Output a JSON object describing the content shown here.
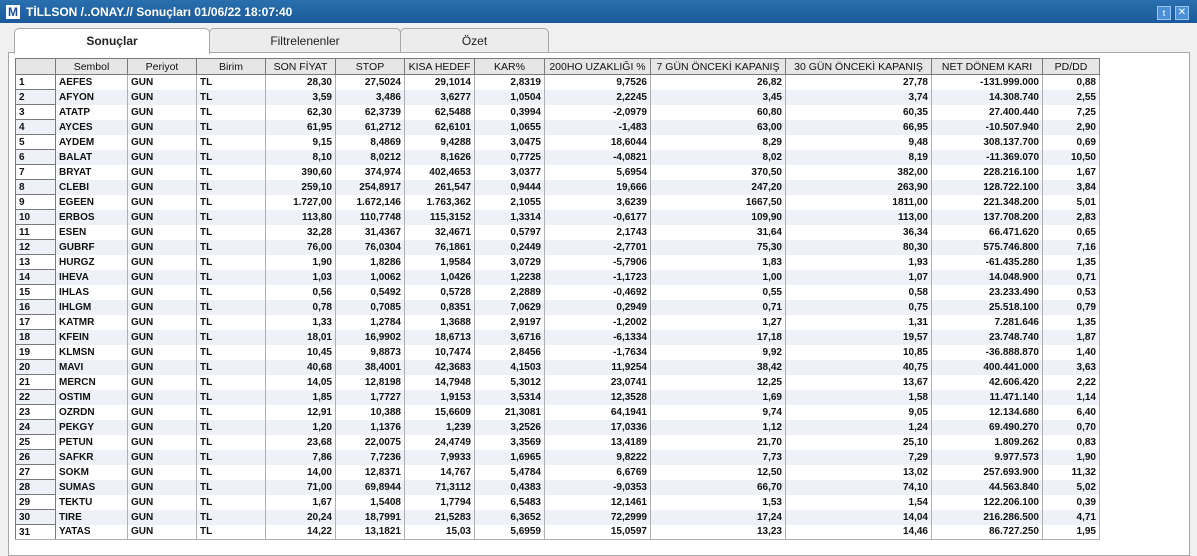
{
  "window": {
    "app_icon": "M",
    "title": "TİLLSON /..ONAY.// Sonuçları  01/06/22 18:07:40",
    "twitter_icon": "twitter-icon",
    "close_icon": "close-icon"
  },
  "tabs": [
    {
      "label": "Sonuçlar",
      "active": true
    },
    {
      "label": "Filtrelenenler",
      "active": false
    },
    {
      "label": "Özet",
      "active": false
    }
  ],
  "table": {
    "columns": [
      "",
      "Sembol",
      "Periyot",
      "Birim",
      "SON FİYAT",
      "STOP",
      "KISA HEDEF",
      "KAR%",
      "200HO UZAKLIĞI %",
      "7 GÜN ÖNCEKİ KAPANIŞ",
      "30 GÜN ÖNCEKİ KAPANIŞ",
      "NET DÖNEM KARI",
      "PD/DD"
    ],
    "rows": [
      [
        "1",
        "AEFES",
        "GUN",
        "TL",
        "28,30",
        "27,5024",
        "29,1014",
        "2,8319",
        "9,7526",
        "26,82",
        "27,78",
        "-131.999.000",
        "0,88"
      ],
      [
        "2",
        "AFYON",
        "GUN",
        "TL",
        "3,59",
        "3,486",
        "3,6277",
        "1,0504",
        "2,2245",
        "3,45",
        "3,74",
        "14.308.740",
        "2,55"
      ],
      [
        "3",
        "ATATP",
        "GUN",
        "TL",
        "62,30",
        "62,3739",
        "62,5488",
        "0,3994",
        "-2,0979",
        "60,80",
        "60,35",
        "27.400.440",
        "7,25"
      ],
      [
        "4",
        "AYCES",
        "GUN",
        "TL",
        "61,95",
        "61,2712",
        "62,6101",
        "1,0655",
        "-1,483",
        "63,00",
        "66,95",
        "-10.507.940",
        "2,90"
      ],
      [
        "5",
        "AYDEM",
        "GUN",
        "TL",
        "9,15",
        "8,4869",
        "9,4288",
        "3,0475",
        "18,6044",
        "8,29",
        "9,48",
        "308.137.700",
        "0,69"
      ],
      [
        "6",
        "BALAT",
        "GUN",
        "TL",
        "8,10",
        "8,0212",
        "8,1626",
        "0,7725",
        "-4,0821",
        "8,02",
        "8,19",
        "-11.369.070",
        "10,50"
      ],
      [
        "7",
        "BRYAT",
        "GUN",
        "TL",
        "390,60",
        "374,974",
        "402,4653",
        "3,0377",
        "5,6954",
        "370,50",
        "382,00",
        "228.216.100",
        "1,67"
      ],
      [
        "8",
        "CLEBI",
        "GUN",
        "TL",
        "259,10",
        "254,8917",
        "261,547",
        "0,9444",
        "19,666",
        "247,20",
        "263,90",
        "128.722.100",
        "3,84"
      ],
      [
        "9",
        "EGEEN",
        "GUN",
        "TL",
        "1.727,00",
        "1.672,146",
        "1.763,362",
        "2,1055",
        "3,6239",
        "1667,50",
        "1811,00",
        "221.348.200",
        "5,01"
      ],
      [
        "10",
        "ERBOS",
        "GUN",
        "TL",
        "113,80",
        "110,7748",
        "115,3152",
        "1,3314",
        "-0,6177",
        "109,90",
        "113,00",
        "137.708.200",
        "2,83"
      ],
      [
        "11",
        "ESEN",
        "GUN",
        "TL",
        "32,28",
        "31,4367",
        "32,4671",
        "0,5797",
        "2,1743",
        "31,64",
        "36,34",
        "66.471.620",
        "0,65"
      ],
      [
        "12",
        "GUBRF",
        "GUN",
        "TL",
        "76,00",
        "76,0304",
        "76,1861",
        "0,2449",
        "-2,7701",
        "75,30",
        "80,30",
        "575.746.800",
        "7,16"
      ],
      [
        "13",
        "HURGZ",
        "GUN",
        "TL",
        "1,90",
        "1,8286",
        "1,9584",
        "3,0729",
        "-5,7906",
        "1,83",
        "1,93",
        "-61.435.280",
        "1,35"
      ],
      [
        "14",
        "IHEVA",
        "GUN",
        "TL",
        "1,03",
        "1,0062",
        "1,0426",
        "1,2238",
        "-1,1723",
        "1,00",
        "1,07",
        "14.048.900",
        "0,71"
      ],
      [
        "15",
        "IHLAS",
        "GUN",
        "TL",
        "0,56",
        "0,5492",
        "0,5728",
        "2,2889",
        "-0,4692",
        "0,55",
        "0,58",
        "23.233.490",
        "0,53"
      ],
      [
        "16",
        "IHLGM",
        "GUN",
        "TL",
        "0,78",
        "0,7085",
        "0,8351",
        "7,0629",
        "0,2949",
        "0,71",
        "0,75",
        "25.518.100",
        "0,79"
      ],
      [
        "17",
        "KATMR",
        "GUN",
        "TL",
        "1,33",
        "1,2784",
        "1,3688",
        "2,9197",
        "-1,2002",
        "1,27",
        "1,31",
        "7.281.646",
        "1,35"
      ],
      [
        "18",
        "KFEIN",
        "GUN",
        "TL",
        "18,01",
        "16,9902",
        "18,6713",
        "3,6716",
        "-6,1334",
        "17,18",
        "19,57",
        "23.748.740",
        "1,87"
      ],
      [
        "19",
        "KLMSN",
        "GUN",
        "TL",
        "10,45",
        "9,8873",
        "10,7474",
        "2,8456",
        "-1,7634",
        "9,92",
        "10,85",
        "-36.888.870",
        "1,40"
      ],
      [
        "20",
        "MAVI",
        "GUN",
        "TL",
        "40,68",
        "38,4001",
        "42,3683",
        "4,1503",
        "11,9254",
        "38,42",
        "40,75",
        "400.441.000",
        "3,63"
      ],
      [
        "21",
        "MERCN",
        "GUN",
        "TL",
        "14,05",
        "12,8198",
        "14,7948",
        "5,3012",
        "23,0741",
        "12,25",
        "13,67",
        "42.606.420",
        "2,22"
      ],
      [
        "22",
        "OSTIM",
        "GUN",
        "TL",
        "1,85",
        "1,7727",
        "1,9153",
        "3,5314",
        "12,3528",
        "1,69",
        "1,58",
        "11.471.140",
        "1,14"
      ],
      [
        "23",
        "OZRDN",
        "GUN",
        "TL",
        "12,91",
        "10,388",
        "15,6609",
        "21,3081",
        "64,1941",
        "9,74",
        "9,05",
        "12.134.680",
        "6,40"
      ],
      [
        "24",
        "PEKGY",
        "GUN",
        "TL",
        "1,20",
        "1,1376",
        "1,239",
        "3,2526",
        "17,0336",
        "1,12",
        "1,24",
        "69.490.270",
        "0,70"
      ],
      [
        "25",
        "PETUN",
        "GUN",
        "TL",
        "23,68",
        "22,0075",
        "24,4749",
        "3,3569",
        "13,4189",
        "21,70",
        "25,10",
        "1.809.262",
        "0,83"
      ],
      [
        "26",
        "SAFKR",
        "GUN",
        "TL",
        "7,86",
        "7,7236",
        "7,9933",
        "1,6965",
        "9,8222",
        "7,73",
        "7,29",
        "9.977.573",
        "1,90"
      ],
      [
        "27",
        "SOKM",
        "GUN",
        "TL",
        "14,00",
        "12,8371",
        "14,767",
        "5,4784",
        "6,6769",
        "12,50",
        "13,02",
        "257.693.900",
        "11,32"
      ],
      [
        "28",
        "SUMAS",
        "GUN",
        "TL",
        "71,00",
        "69,8944",
        "71,3112",
        "0,4383",
        "-9,0353",
        "66,70",
        "74,10",
        "44.563.840",
        "5,02"
      ],
      [
        "29",
        "TEKTU",
        "GUN",
        "TL",
        "1,67",
        "1,5408",
        "1,7794",
        "6,5483",
        "12,1461",
        "1,53",
        "1,54",
        "122.206.100",
        "0,39"
      ],
      [
        "30",
        "TIRE",
        "GUN",
        "TL",
        "20,24",
        "18,7991",
        "21,5283",
        "6,3652",
        "72,2999",
        "17,24",
        "14,04",
        "216.286.500",
        "4,71"
      ],
      [
        "31",
        "YATAS",
        "GUN",
        "TL",
        "14,22",
        "13,1821",
        "15,03",
        "5,6959",
        "15,0597",
        "13,23",
        "14,46",
        "86.727.250",
        "1,95"
      ]
    ]
  }
}
